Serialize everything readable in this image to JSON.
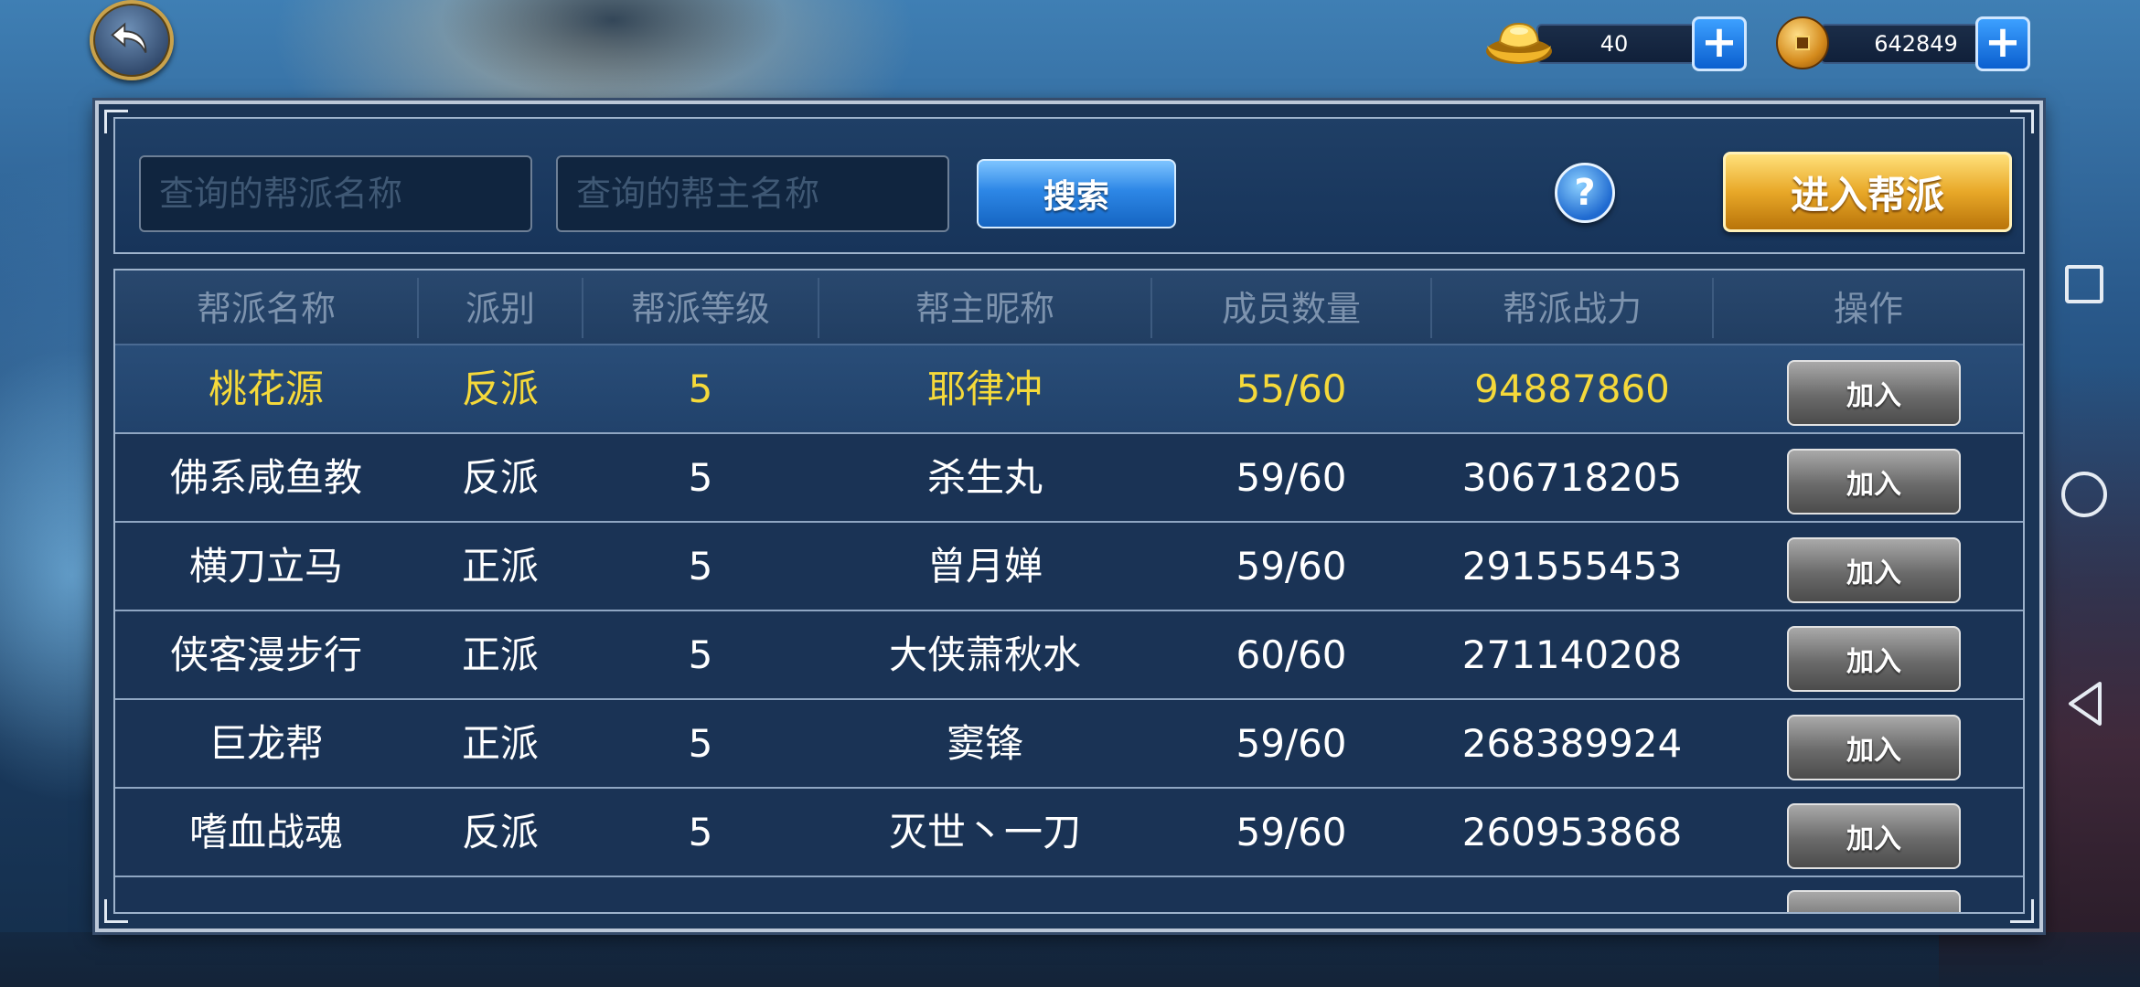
{
  "header": {
    "gold_ingot": {
      "icon": "gold-ingot-icon",
      "value": "40"
    },
    "copper_coin": {
      "icon": "copper-coin-icon",
      "value": "642849"
    }
  },
  "search": {
    "guild_name_placeholder": "查询的帮派名称",
    "leader_name_placeholder": "查询的帮主名称",
    "search_label": "搜索",
    "help_label": "?",
    "enter_label": "进入帮派"
  },
  "table": {
    "headers": [
      "帮派名称",
      "派别",
      "帮派等级",
      "帮主昵称",
      "成员数量",
      "帮派战力",
      "操作"
    ],
    "rows": [
      {
        "name": "桃花源",
        "faction": "反派",
        "level": "5",
        "leader": "耶律冲",
        "members": "55/60",
        "power": "94887860",
        "action": "加入"
      },
      {
        "name": "佛系咸鱼教",
        "faction": "反派",
        "level": "5",
        "leader": "杀生丸",
        "members": "59/60",
        "power": "306718205",
        "action": "加入"
      },
      {
        "name": "横刀立马",
        "faction": "正派",
        "level": "5",
        "leader": "曾月婵",
        "members": "59/60",
        "power": "291555453",
        "action": "加入"
      },
      {
        "name": "侠客漫步行",
        "faction": "正派",
        "level": "5",
        "leader": "大侠萧秋水",
        "members": "60/60",
        "power": "271140208",
        "action": "加入"
      },
      {
        "name": "巨龙帮",
        "faction": "正派",
        "level": "5",
        "leader": "窦锋",
        "members": "59/60",
        "power": "268389924",
        "action": "加入"
      },
      {
        "name": "嗜血战魂",
        "faction": "反派",
        "level": "5",
        "leader": "灭世丶一刀",
        "members": "59/60",
        "power": "260953868",
        "action": "加入"
      }
    ]
  },
  "colors": {
    "selected_text": "#f5d93a",
    "header_text": "#7d93ae",
    "panel_bg": "#1b3556"
  }
}
